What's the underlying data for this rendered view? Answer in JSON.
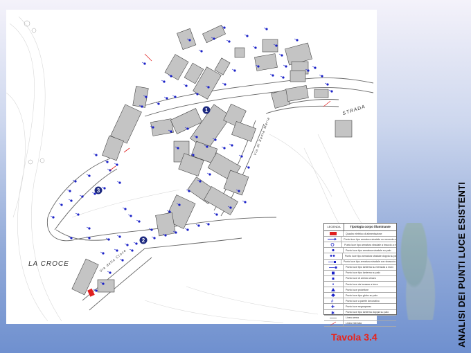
{
  "side_title": "ANALISI DEI PUNTI LUCE ESISTENTI",
  "sheet_label": "Tavola 3.4",
  "place_names": [
    "LA CROCE",
    "STRADA"
  ],
  "street_labels": [
    "Via della Croce",
    "Via di Santa Maria"
  ],
  "zone_markers": [
    "1",
    "2",
    "3"
  ],
  "legend": {
    "header_symbol_column": "LEGENDA",
    "header_title": "Tipologia corpo illuminante",
    "rows": [
      {
        "symbol": "panel",
        "text": "Quadro elettrico di alimentazione"
      },
      {
        "symbol": "arrow-lamp",
        "text": "Punto luce tipo armatura stradale su mensola a muro"
      },
      {
        "symbol": "circle-lamp",
        "text": "Punto luce tipo armatura stradale a braccio a muro"
      },
      {
        "symbol": "dot-lamp",
        "text": "Punto luce tipo armatura stradale su palo"
      },
      {
        "symbol": "double-lamp",
        "text": "Punto luce tipo armatura stradale doppia su palo"
      },
      {
        "symbol": "square-lamp",
        "text": "Punto luce tipo armatura stradale con sbraccio a muro"
      },
      {
        "symbol": "lantern",
        "text": "Punto luce tipo lanterna su mensola a muro"
      },
      {
        "symbol": "lantern-pole",
        "text": "Punto luce tipo lanterna su palo"
      },
      {
        "symbol": "filled-square",
        "text": "Punto luce di arredo urbano"
      },
      {
        "symbol": "small-dot",
        "text": "Punto luce da incasso a terra"
      },
      {
        "symbol": "triangle",
        "text": "Punto luce proiettore"
      },
      {
        "symbol": "diamond",
        "text": "Punto luce tipo globo su palo"
      },
      {
        "symbol": "hash",
        "text": "Punto luce a parete decorativo"
      },
      {
        "symbol": "cross",
        "text": "Punto luce segnapasso"
      },
      {
        "symbol": "star",
        "text": "Punto luce tipo lanterna doppia su palo"
      },
      {
        "symbol": "line",
        "text": "Linea aerea"
      },
      {
        "symbol": "red-line",
        "text": "Linea interrata"
      }
    ]
  },
  "colors": {
    "lamp_blue": "#1b22c8",
    "panel_red": "#e02020",
    "building_gray": "#c4c4c4",
    "road_line": "#555555",
    "title_red": "#e8231b"
  }
}
